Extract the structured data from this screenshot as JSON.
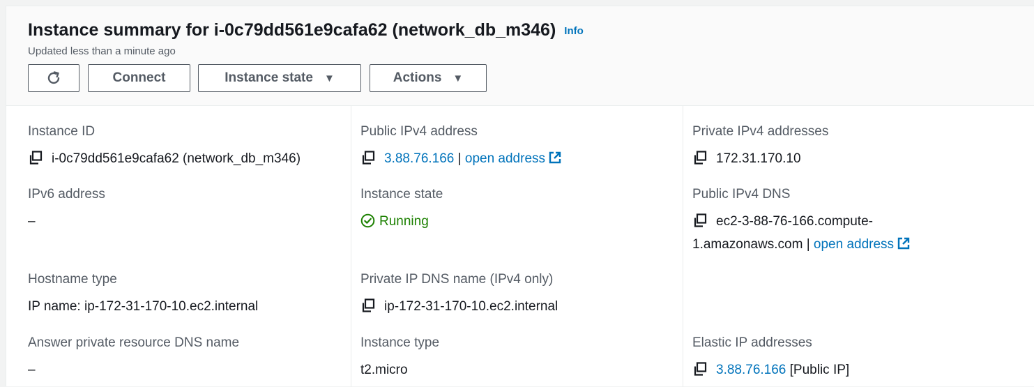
{
  "header": {
    "title": "Instance summary for i-0c79dd561e9cafa62 (network_db_m346)",
    "info_label": "Info",
    "updated": "Updated less than a minute ago",
    "buttons": {
      "connect": "Connect",
      "instance_state": "Instance state",
      "actions": "Actions"
    },
    "icons": {
      "refresh": "refresh-icon",
      "caret": "caret-down-icon"
    }
  },
  "fields": {
    "instance_id": {
      "label": "Instance ID",
      "value": "i-0c79dd561e9cafa62 (network_db_m346)"
    },
    "public_ipv4": {
      "label": "Public IPv4 address",
      "value": "3.88.76.166",
      "separator": "|",
      "link": "open address"
    },
    "private_ipv4": {
      "label": "Private IPv4 addresses",
      "value": "172.31.170.10"
    },
    "ipv6": {
      "label": "IPv6 address",
      "value": "–"
    },
    "instance_state": {
      "label": "Instance state",
      "value": "Running"
    },
    "public_dns": {
      "label": "Public IPv4 DNS",
      "value": "ec2-3-88-76-166.compute-1.amazonaws.com",
      "separator": "|",
      "link": "open address"
    },
    "hostname_type": {
      "label": "Hostname type",
      "value": "IP name: ip-172-31-170-10.ec2.internal"
    },
    "private_dns": {
      "label": "Private IP DNS name (IPv4 only)",
      "value": "ip-172-31-170-10.ec2.internal"
    },
    "answer_dns": {
      "label": "Answer private resource DNS name",
      "value": "–"
    },
    "instance_type": {
      "label": "Instance type",
      "value": "t2.micro"
    },
    "elastic_ip": {
      "label": "Elastic IP addresses",
      "value": "3.88.76.166",
      "suffix": "[Public IP]"
    }
  },
  "colors": {
    "link": "#0073bb",
    "running": "#1d8102",
    "text": "#16191f",
    "label": "#545b64"
  }
}
